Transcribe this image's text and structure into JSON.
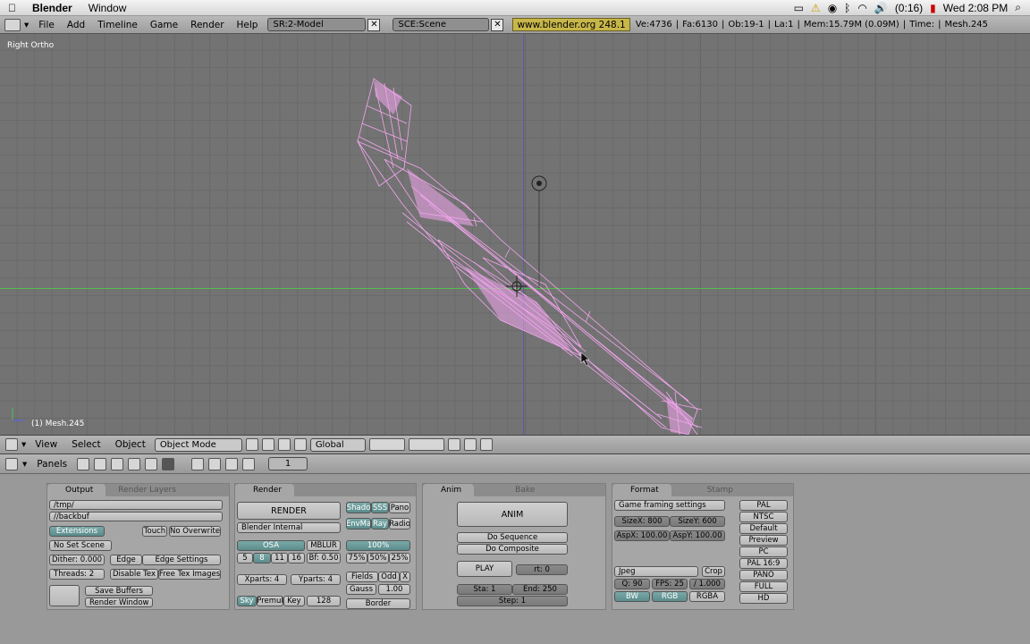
{
  "mac": {
    "app": "Blender",
    "menu1": "Window",
    "battery": "(0:16)",
    "clock": "Wed 2:08 PM"
  },
  "top": {
    "menus": [
      "File",
      "Add",
      "Timeline",
      "Game",
      "Render",
      "Help"
    ],
    "screen": "SR:2-Model",
    "scene": "SCE:Scene",
    "url": "www.blender.org 248.1",
    "stats": [
      "Ve:4736",
      "Fa:6130",
      "Ob:19-1",
      "La:1",
      "Mem:15.79M (0.09M)",
      "Time:",
      "Mesh.245"
    ]
  },
  "viewport": {
    "view_label": "Right Ortho",
    "object_label": "(1) Mesh.245"
  },
  "view_header": {
    "menus": [
      "View",
      "Select",
      "Object"
    ],
    "mode": "Object Mode",
    "orientation": "Global"
  },
  "buttons_header": {
    "panels_label": "Panels",
    "frame": "1"
  },
  "output": {
    "tab_active": "Output",
    "tab_inactive": "Render Layers",
    "path1": "/tmp/",
    "path2": "//backbuf",
    "extensions": "Extensions",
    "touch": "Touch",
    "no_overwrite": "No Overwrite",
    "no_set_scene": "No Set Scene",
    "dither": "Dither: 0.000",
    "edge": "Edge",
    "edge_settings": "Edge Settings",
    "threads": "Threads: 2",
    "disable_tex": "Disable Tex",
    "free_tex": "Free Tex Images",
    "save_buffers": "Save Buffers",
    "render_window": "Render Window"
  },
  "render": {
    "tab": "Render",
    "render_btn": "RENDER",
    "shado": "Shado",
    "sss": "SSS",
    "pano": "Pano",
    "renderer": "Blender Internal",
    "envma": "EnvMa",
    "ray": "Ray",
    "radio": "Radio",
    "osa": "OSA",
    "mblur": "MBLUR",
    "pct100": "100%",
    "osa_vals": [
      "5",
      "8",
      "11",
      "16"
    ],
    "bf": "Bf: 0.50",
    "pcts": [
      "75%",
      "50%",
      "25%"
    ],
    "xparts": "Xparts: 4",
    "yparts": "Yparts: 4",
    "fields": "Fields",
    "odd": "Odd",
    "x": "X",
    "gauss": "Gauss",
    "gauss_val": "1.00",
    "sky": "Sky",
    "premul": "Premul",
    "key": "Key",
    "bits": "128",
    "border": "Border"
  },
  "anim": {
    "tab_active": "Anim",
    "tab_inactive": "Bake",
    "anim_btn": "ANIM",
    "do_sequence": "Do Sequence",
    "do_composite": "Do Composite",
    "play": "PLAY",
    "rt": "rt: 0",
    "sta": "Sta: 1",
    "end": "End: 250",
    "step": "Step: 1"
  },
  "format": {
    "tab_active": "Format",
    "tab_inactive": "Stamp",
    "game_framing": "Game framing settings",
    "sizex": "SizeX: 800",
    "sizey": "SizeY: 600",
    "aspx": "AspX: 100.00",
    "aspy": "AspY: 100.00",
    "filetype": "Jpeg",
    "crop": "Crop",
    "q": "Q: 90",
    "fps": "FPS: 25",
    "fps_div": "/ 1.000",
    "bw": "BW",
    "rgb": "RGB",
    "rgba": "RGBA",
    "presets": [
      "PAL",
      "NTSC",
      "Default",
      "Preview",
      "PC",
      "PAL 16:9",
      "PANO",
      "FULL",
      "HD"
    ]
  }
}
